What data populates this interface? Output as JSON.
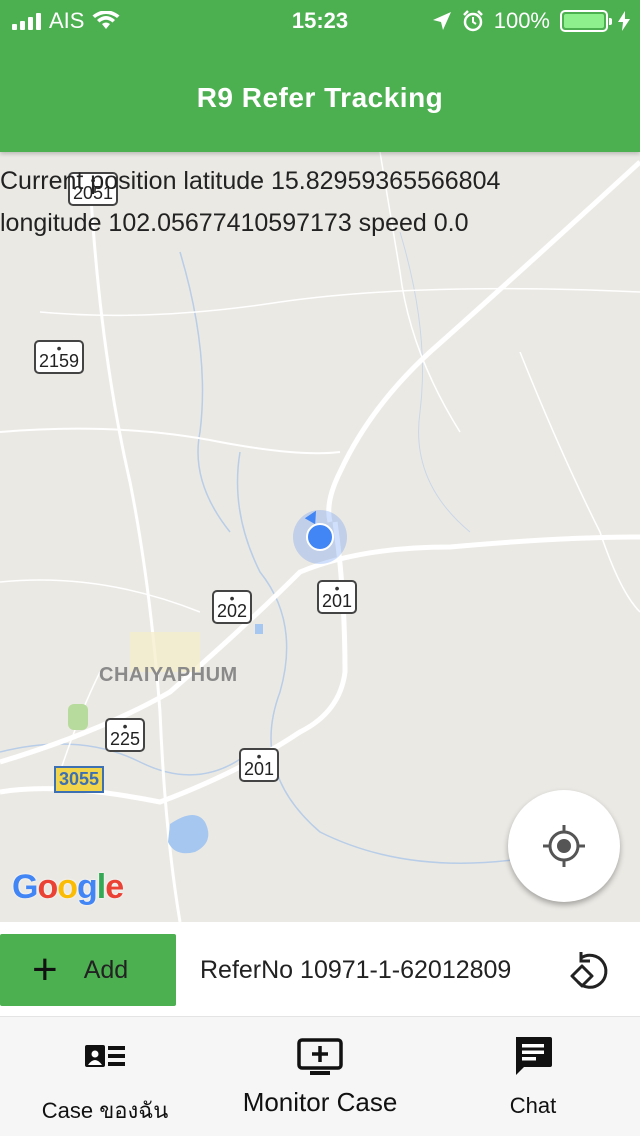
{
  "status_bar": {
    "carrier": "AIS",
    "time": "15:23",
    "battery": "100%",
    "icons": [
      "signal-icon",
      "wifi-icon",
      "location-arrow-icon",
      "alarm-icon",
      "battery-icon",
      "charging-icon"
    ]
  },
  "header": {
    "title": "R9 Refer Tracking"
  },
  "map": {
    "info_line1": "Current position latitude   15.82959365566804",
    "info_line2": "longitude 102.05677410597173      speed 0.0",
    "route_shields": [
      "2051",
      "2159",
      "202",
      "201",
      "225",
      "201"
    ],
    "highway_badge": "3055",
    "town_label": "CHAIYAPHUM",
    "google_logo": [
      "G",
      "o",
      "o",
      "g",
      "l",
      "e"
    ]
  },
  "action_row": {
    "add_label": "Add",
    "refer_no": "ReferNo 10971-1-62012809"
  },
  "tabs": [
    {
      "label": "Case ของฉัน",
      "icon": "id-card-icon"
    },
    {
      "label": "Monitor Case",
      "icon": "monitor-plus-icon"
    },
    {
      "label": "Chat",
      "icon": "chat-icon"
    }
  ],
  "colors": {
    "primary": "#4caf50",
    "map_background": "#ebe9e4",
    "location_dot": "#4285f4"
  }
}
